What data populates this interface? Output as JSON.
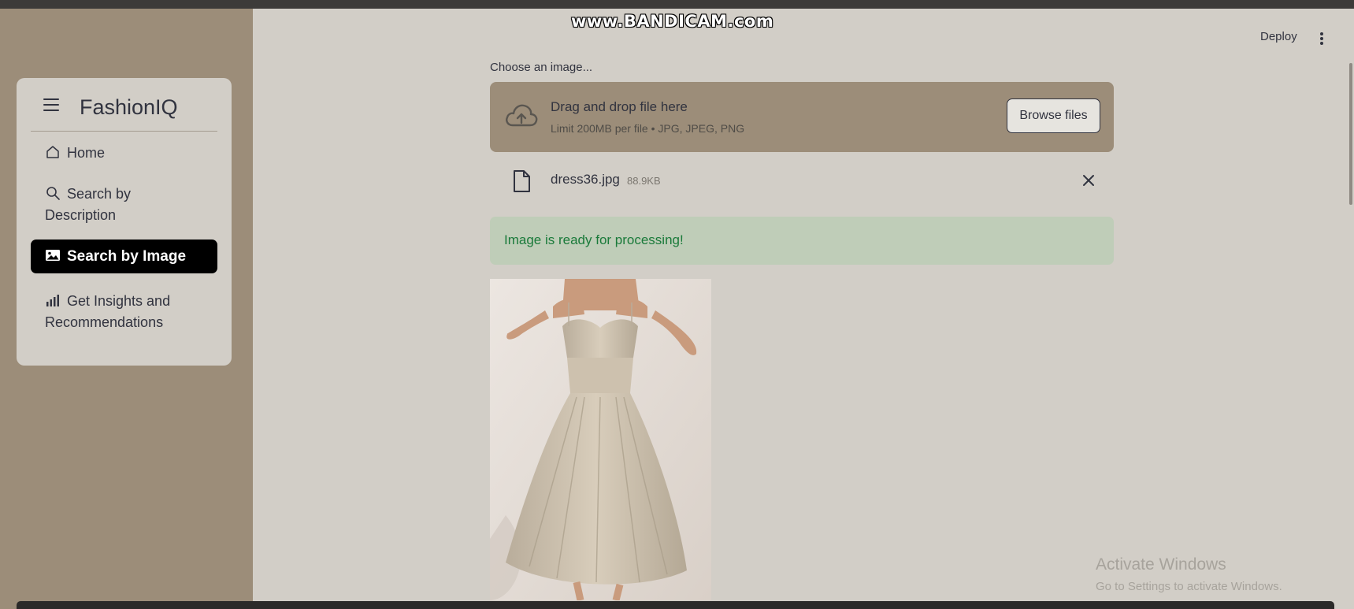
{
  "watermark": "www.BANDICAM.com",
  "sidebar": {
    "brand": "FashionIQ",
    "items": [
      {
        "label": "Home",
        "icon": "home-icon",
        "active": false
      },
      {
        "label_line1": "Search by",
        "label_line2": "Description",
        "icon": "search-icon",
        "active": false
      },
      {
        "label": "Search by Image",
        "icon": "image-icon",
        "active": true
      },
      {
        "label_line1": "Get Insights and",
        "label_line2": "Recommendations",
        "icon": "bar-chart-icon",
        "active": false
      }
    ]
  },
  "header": {
    "deploy_label": "Deploy",
    "menu_icon": "kebab-menu-icon"
  },
  "uploader": {
    "label": "Choose an image...",
    "drop_title": "Drag and drop file here",
    "drop_subtitle": "Limit 200MB per file • JPG, JPEG, PNG",
    "browse_label": "Browse files",
    "file": {
      "name": "dress36.jpg",
      "size": "88.9KB"
    }
  },
  "status": {
    "message": "Image is ready for processing!"
  },
  "os_overlay": {
    "line1": "Activate Windows",
    "line2": "Go to Settings to activate Windows."
  },
  "colors": {
    "sidebar_bg": "#9c8d79",
    "main_bg": "#d2cec7",
    "active_item_bg": "#000000",
    "success_bg": "#bfcdb8",
    "success_text": "#1a7a3a"
  }
}
